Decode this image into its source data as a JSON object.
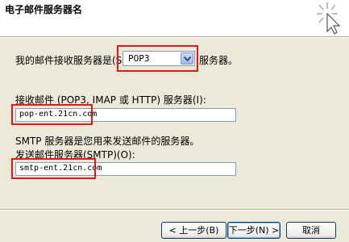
{
  "header": {
    "title": "电子邮件服务器名"
  },
  "incoming_type": {
    "label": "我的邮件接收服务器是(S)",
    "selected": "POP3",
    "suffix": "服务器。"
  },
  "incoming_server": {
    "label": "接收邮件 (POP3, IMAP 或 HTTP) 服务器(I):",
    "value": "pop-ent.21cn.com"
  },
  "smtp_info": "SMTP 服务器是您用来发送邮件的服务器。",
  "outgoing_server": {
    "label": "发送邮件服务器(SMTP)(O):",
    "value": "smtp-ent.21cn.com"
  },
  "buttons": {
    "back": "< 上一步(B)",
    "next": "下一步(N) >",
    "cancel": "取消"
  },
  "colors": {
    "highlight": "#e8141a",
    "field_border": "#7f9db9",
    "dialog_bg": "#ece9d8"
  }
}
